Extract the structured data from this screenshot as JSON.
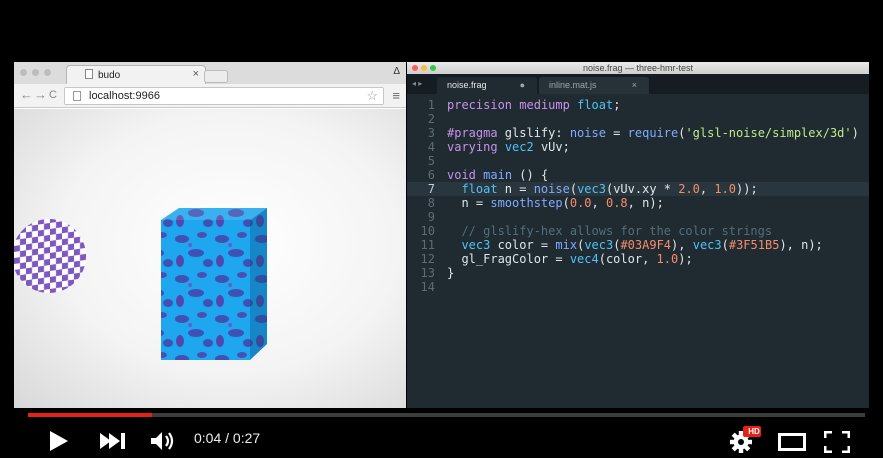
{
  "browser": {
    "tab_title": "budo",
    "tab_close": "×",
    "profile_glyph": "Δ",
    "url": "localhost:9966",
    "back_glyph": "←",
    "forward_glyph": "→",
    "reload_glyph": "C",
    "star_glyph": "☆",
    "menu_glyph": "≡"
  },
  "editor": {
    "window_title": "noise.frag — three-hmr-test",
    "tab_arrows": "◂ ▸",
    "tabs": [
      {
        "label": "noise.frag",
        "marker": "●"
      },
      {
        "label": "inline.mat.js",
        "marker": "×"
      }
    ],
    "line_numbers": [
      "1",
      "2",
      "3",
      "4",
      "5",
      "6",
      "7",
      "8",
      "9",
      "10",
      "11",
      "12",
      "13",
      "14"
    ],
    "code_lines": [
      "precision mediump float;",
      "",
      "#pragma glslify: noise = require('glsl-noise/simplex/3d')",
      "varying vec2 vUv;",
      "",
      "void main () {",
      "  float n = noise(vec3(vUv.xy * 2.0, 1.0));",
      "  n = smoothstep(0.0, 0.8, n);",
      "",
      "  // glslify-hex allows for the color strings",
      "  vec3 color = mix(vec3(#03A9F4), vec3(#3F51B5), n);",
      "  gl_FragColor = vec4(color, 1.0);",
      "}",
      ""
    ],
    "highlighted_line": 7
  },
  "player": {
    "time_display": "0:04 / 0:27",
    "progress": 0.148,
    "hd_badge": "HD",
    "accent_color": "#e62117",
    "icons": [
      "play-icon",
      "next-icon",
      "volume-icon",
      "settings-icon",
      "theater-mode-icon",
      "fullscreen-icon"
    ]
  },
  "colors": {
    "cube_base": "#03A9F4",
    "cube_spots": "#3F51B5",
    "sphere_a": "#7e57c2",
    "sphere_b": "#ffffff"
  }
}
